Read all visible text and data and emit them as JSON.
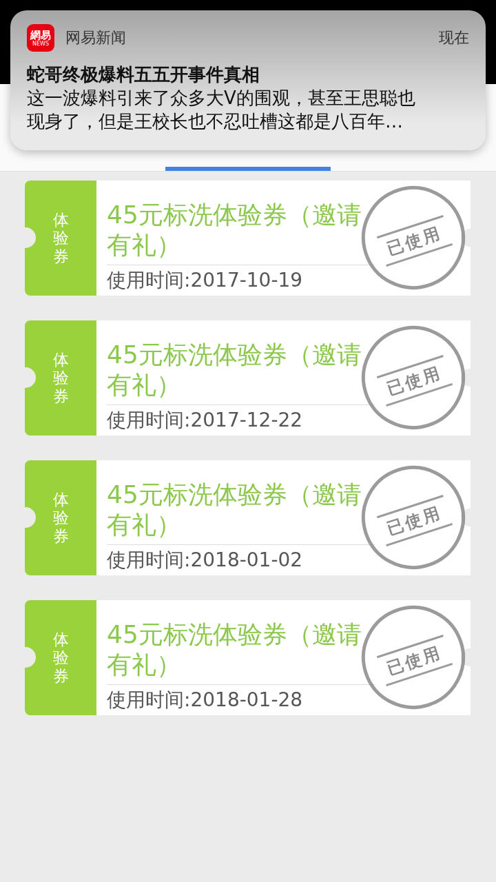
{
  "notification": {
    "app_icon": {
      "text": "網易",
      "subtext": "NEWS"
    },
    "app_name": "网易新闻",
    "time": "现在",
    "title": "蛇哥终极爆料五五开事件真相",
    "body": "这一波爆料引来了众多大V的围观，甚至王思聪也现身了，但是王校长也不忍吐槽这都是八百年…"
  },
  "coupons": [
    {
      "tag": "体验券",
      "title": "45元标洗体验券（邀请有礼）",
      "date": "使用时间:2017-10-19",
      "used": true,
      "stamp": "已使用"
    },
    {
      "tag": "体验券",
      "title": "45元标洗体验券（邀请有礼）",
      "date": "使用时间:2017-12-22",
      "used": true,
      "stamp": "已使用"
    },
    {
      "tag": "体验券",
      "title": "45元标洗体验券（邀请有礼）",
      "date": "使用时间:2018-01-02",
      "used": true,
      "stamp": "已使用"
    },
    {
      "tag": "体验券",
      "title": "45元标洗体验券（邀请有礼）",
      "date": "使用时间:2018-01-28",
      "used": true,
      "stamp": "已使用"
    }
  ]
}
